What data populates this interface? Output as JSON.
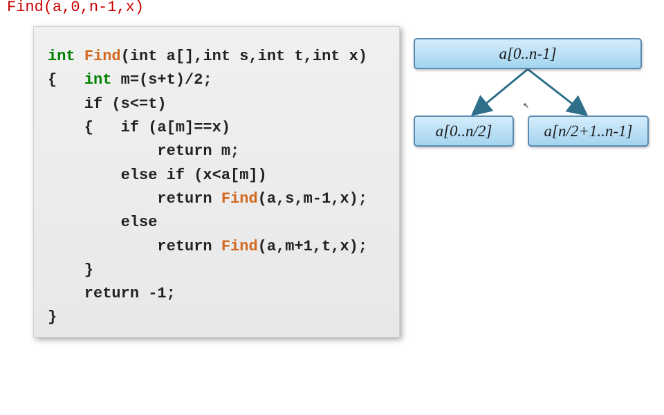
{
  "top_fragment": "Find(a,0,n-1,x)",
  "code": {
    "signature": {
      "ret": "int",
      "name": "Find",
      "params_raw": "(int a[],int s,int t,int x)"
    },
    "lines": {
      "l1_open": "{   ",
      "l1_type": "int",
      "l1_rest": " m=(s+t)/2;",
      "l2": "    if (s<=t)",
      "l3": "    {   if (a[m]==x)",
      "l4": "            return m;",
      "l5": "        else if (x<a[m])",
      "l6_pre": "            return ",
      "l6_call": "Find",
      "l6_post": "(a,s,m-1,x);",
      "l7": "        else",
      "l8_pre": "            return ",
      "l8_call": "Find",
      "l8_post": "(a,m+1,t,x);",
      "l9": "    }",
      "l10": "    return -1;",
      "l11": "}"
    }
  },
  "diagram": {
    "root": "a[0..n-1]",
    "left": "a[0..n/2]",
    "right": "a[n/2+1..n-1]"
  },
  "colors": {
    "box_border": "#5b8bb0",
    "box_fill_top": "#d4ecfb",
    "box_fill_bot": "#a4d4f0",
    "arrow": "#2f6f8a",
    "kw_type": "#008000",
    "kw_func": "#d2691e"
  }
}
